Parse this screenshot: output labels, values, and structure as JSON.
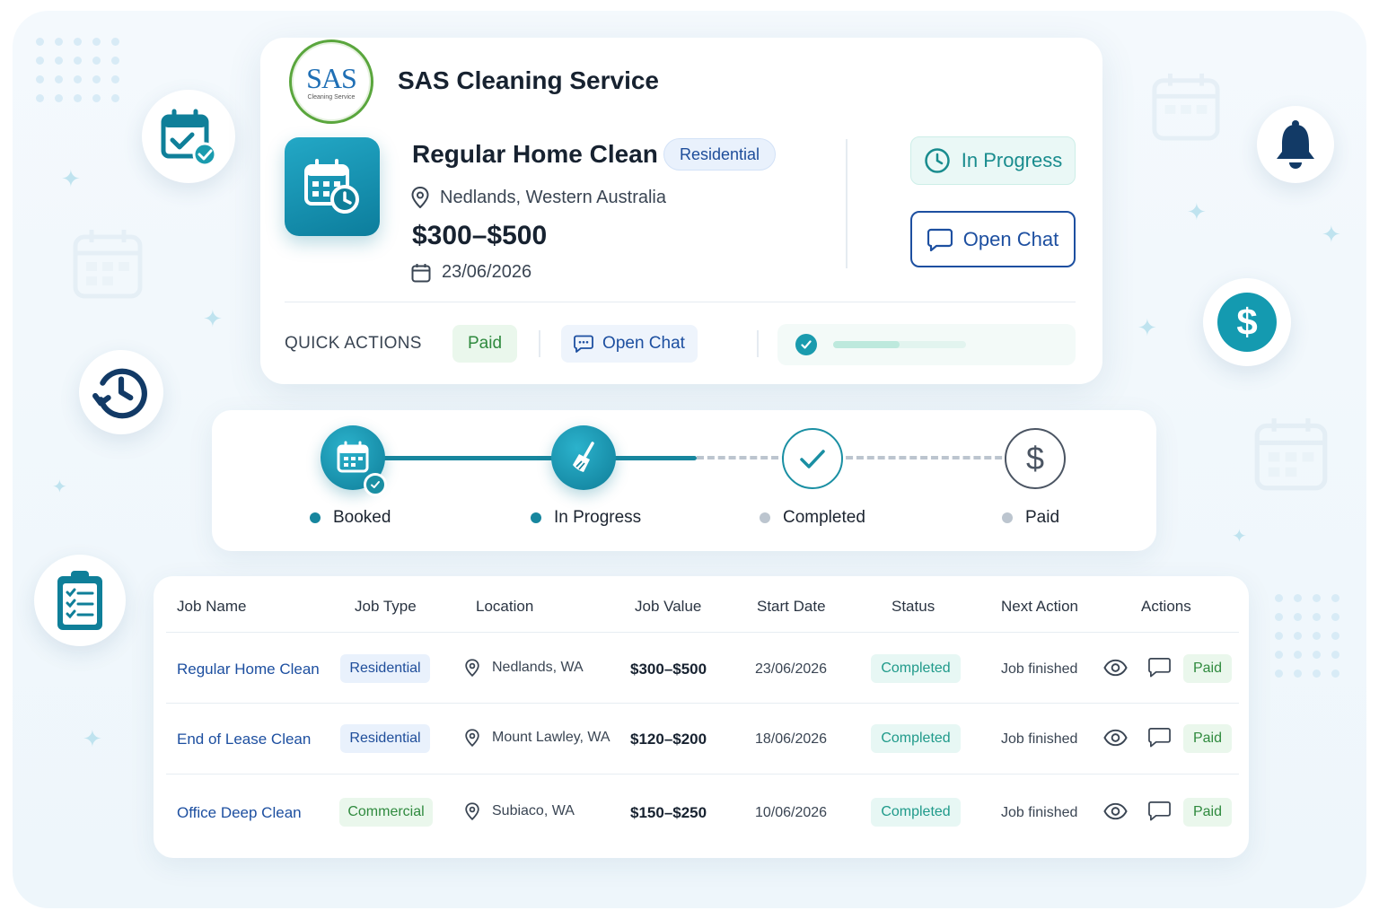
{
  "brand": {
    "logo_text": "SAS",
    "logo_subtext": "Cleaning Service",
    "company_name": "SAS Cleaning Service"
  },
  "job": {
    "title": "Regular Home Clean",
    "type": "Residential",
    "location": "Nedlands, Western Australia",
    "price": "$300–$500",
    "date": "23/06/2026",
    "status_label": "In Progress",
    "chat_label": "Open Chat"
  },
  "quick_actions": {
    "label": "QUICK ACTIONS",
    "paid_label": "Paid",
    "chat_label": "Open Chat",
    "progress": 0.5
  },
  "timeline": {
    "steps": [
      {
        "label": "Booked",
        "state": "done"
      },
      {
        "label": "In Progress",
        "state": "active"
      },
      {
        "label": "Completed",
        "state": "pending"
      },
      {
        "label": "Paid",
        "state": "pending"
      }
    ]
  },
  "table": {
    "headers": [
      "Job Name",
      "Job Type",
      "Location",
      "Job Value",
      "Start Date",
      "Status",
      "Next Action",
      "Actions"
    ],
    "rows": [
      {
        "name": "Regular Home Clean",
        "type": "Residential",
        "location": "Nedlands, WA",
        "value": "$300–$500",
        "start": "23/06/2026",
        "status": "Completed",
        "next": "Job finished",
        "action_pill": "Paid"
      },
      {
        "name": "End of Lease Clean",
        "type": "Residential",
        "location": "Mount Lawley, WA",
        "value": "$120–$200",
        "start": "18/06/2026",
        "status": "Completed",
        "next": "Job finished",
        "action_pill": "Paid"
      },
      {
        "name": "Office Deep Clean",
        "type": "Commercial",
        "location": "Subiaco, WA",
        "value": "$150–$250",
        "start": "10/06/2026",
        "status": "Completed",
        "next": "Job finished",
        "action_pill": "Paid"
      }
    ]
  },
  "decor_icons": [
    "calendar-check-icon",
    "history-icon",
    "clipboard-icon",
    "bell-icon",
    "dollar-icon"
  ],
  "colors": {
    "teal": "#17869e",
    "navy": "#1d4fa0",
    "green": "#2f8a3e",
    "gray": "#bcc5cf"
  }
}
